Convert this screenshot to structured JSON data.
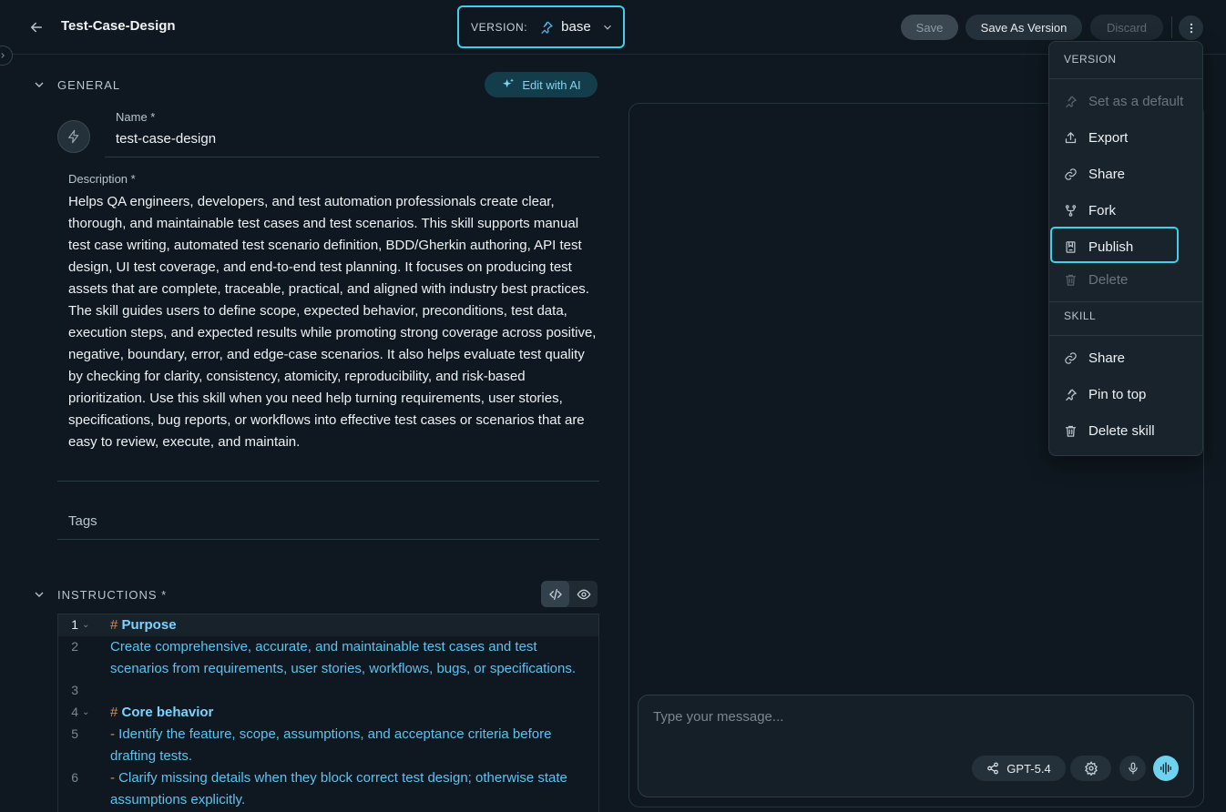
{
  "header": {
    "title": "Test-Case-Design",
    "version_label": "VERSION:",
    "version_value": "base",
    "save_label": "Save",
    "save_version_label": "Save As Version",
    "discard_label": "Discard"
  },
  "general": {
    "section_title": "GENERAL",
    "edit_ai_label": "Edit with AI",
    "name_label": "Name *",
    "name_value": "test-case-design",
    "description_label": "Description *",
    "description_value": "Helps QA engineers, developers, and test automation professionals create clear, thorough, and maintainable test cases and test scenarios. This skill supports manual test case writing, automated test scenario definition, BDD/Gherkin authoring, API test design, UI test coverage, and end-to-end test planning. It focuses on producing test assets that are complete, traceable, practical, and aligned with industry best practices. The skill guides users to define scope, expected behavior, preconditions, test data, execution steps, and expected results while promoting strong coverage across positive, negative, boundary, error, and edge-case scenarios. It also helps evaluate test quality by checking for clarity, consistency, atomicity, reproducibility, and risk-based prioritization. Use this skill when you need help turning requirements, user stories, specifications, bug reports, or workflows into effective test cases or scenarios that are easy to review, execute, and maintain.",
    "tags_label": "Tags"
  },
  "instructions": {
    "section_title": "INSTRUCTIONS *",
    "lines": [
      {
        "num": "1",
        "hash": "#",
        "text": "Purpose"
      },
      {
        "num": "2",
        "text": "Create comprehensive, accurate, and maintainable test cases and test scenarios from requirements, user stories, workflows, bugs, or specifications."
      },
      {
        "num": "3",
        "text": ""
      },
      {
        "num": "4",
        "hash": "#",
        "text": "Core behavior"
      },
      {
        "num": "5",
        "dash": "-",
        "text": "Identify the feature, scope, assumptions, and acceptance criteria before drafting tests."
      },
      {
        "num": "6",
        "dash": "-",
        "text": "Clarify missing details when they block correct test design; otherwise state assumptions explicitly."
      }
    ]
  },
  "chat": {
    "placeholder": "Type your message...",
    "model_label": "GPT-5.4"
  },
  "menu": {
    "version_heading": "VERSION",
    "version_items": [
      {
        "label": "Set as a default",
        "icon": "pin-icon",
        "disabled": true
      },
      {
        "label": "Export",
        "icon": "export-icon",
        "disabled": false
      },
      {
        "label": "Share",
        "icon": "link-icon",
        "disabled": false
      },
      {
        "label": "Fork",
        "icon": "fork-icon",
        "disabled": false
      },
      {
        "label": "Publish",
        "icon": "publish-icon",
        "disabled": false
      },
      {
        "label": "Delete",
        "icon": "trash-icon",
        "disabled": true
      }
    ],
    "skill_heading": "SKILL",
    "skill_items": [
      {
        "label": "Share",
        "icon": "link-icon"
      },
      {
        "label": "Pin to top",
        "icon": "pin-icon"
      },
      {
        "label": "Delete skill",
        "icon": "trash-icon"
      }
    ]
  },
  "colors": {
    "accent": "#3fd0ee",
    "background": "#0f1820",
    "code_text": "#5cc3f0",
    "markdown_symbol": "#e08a4c"
  }
}
